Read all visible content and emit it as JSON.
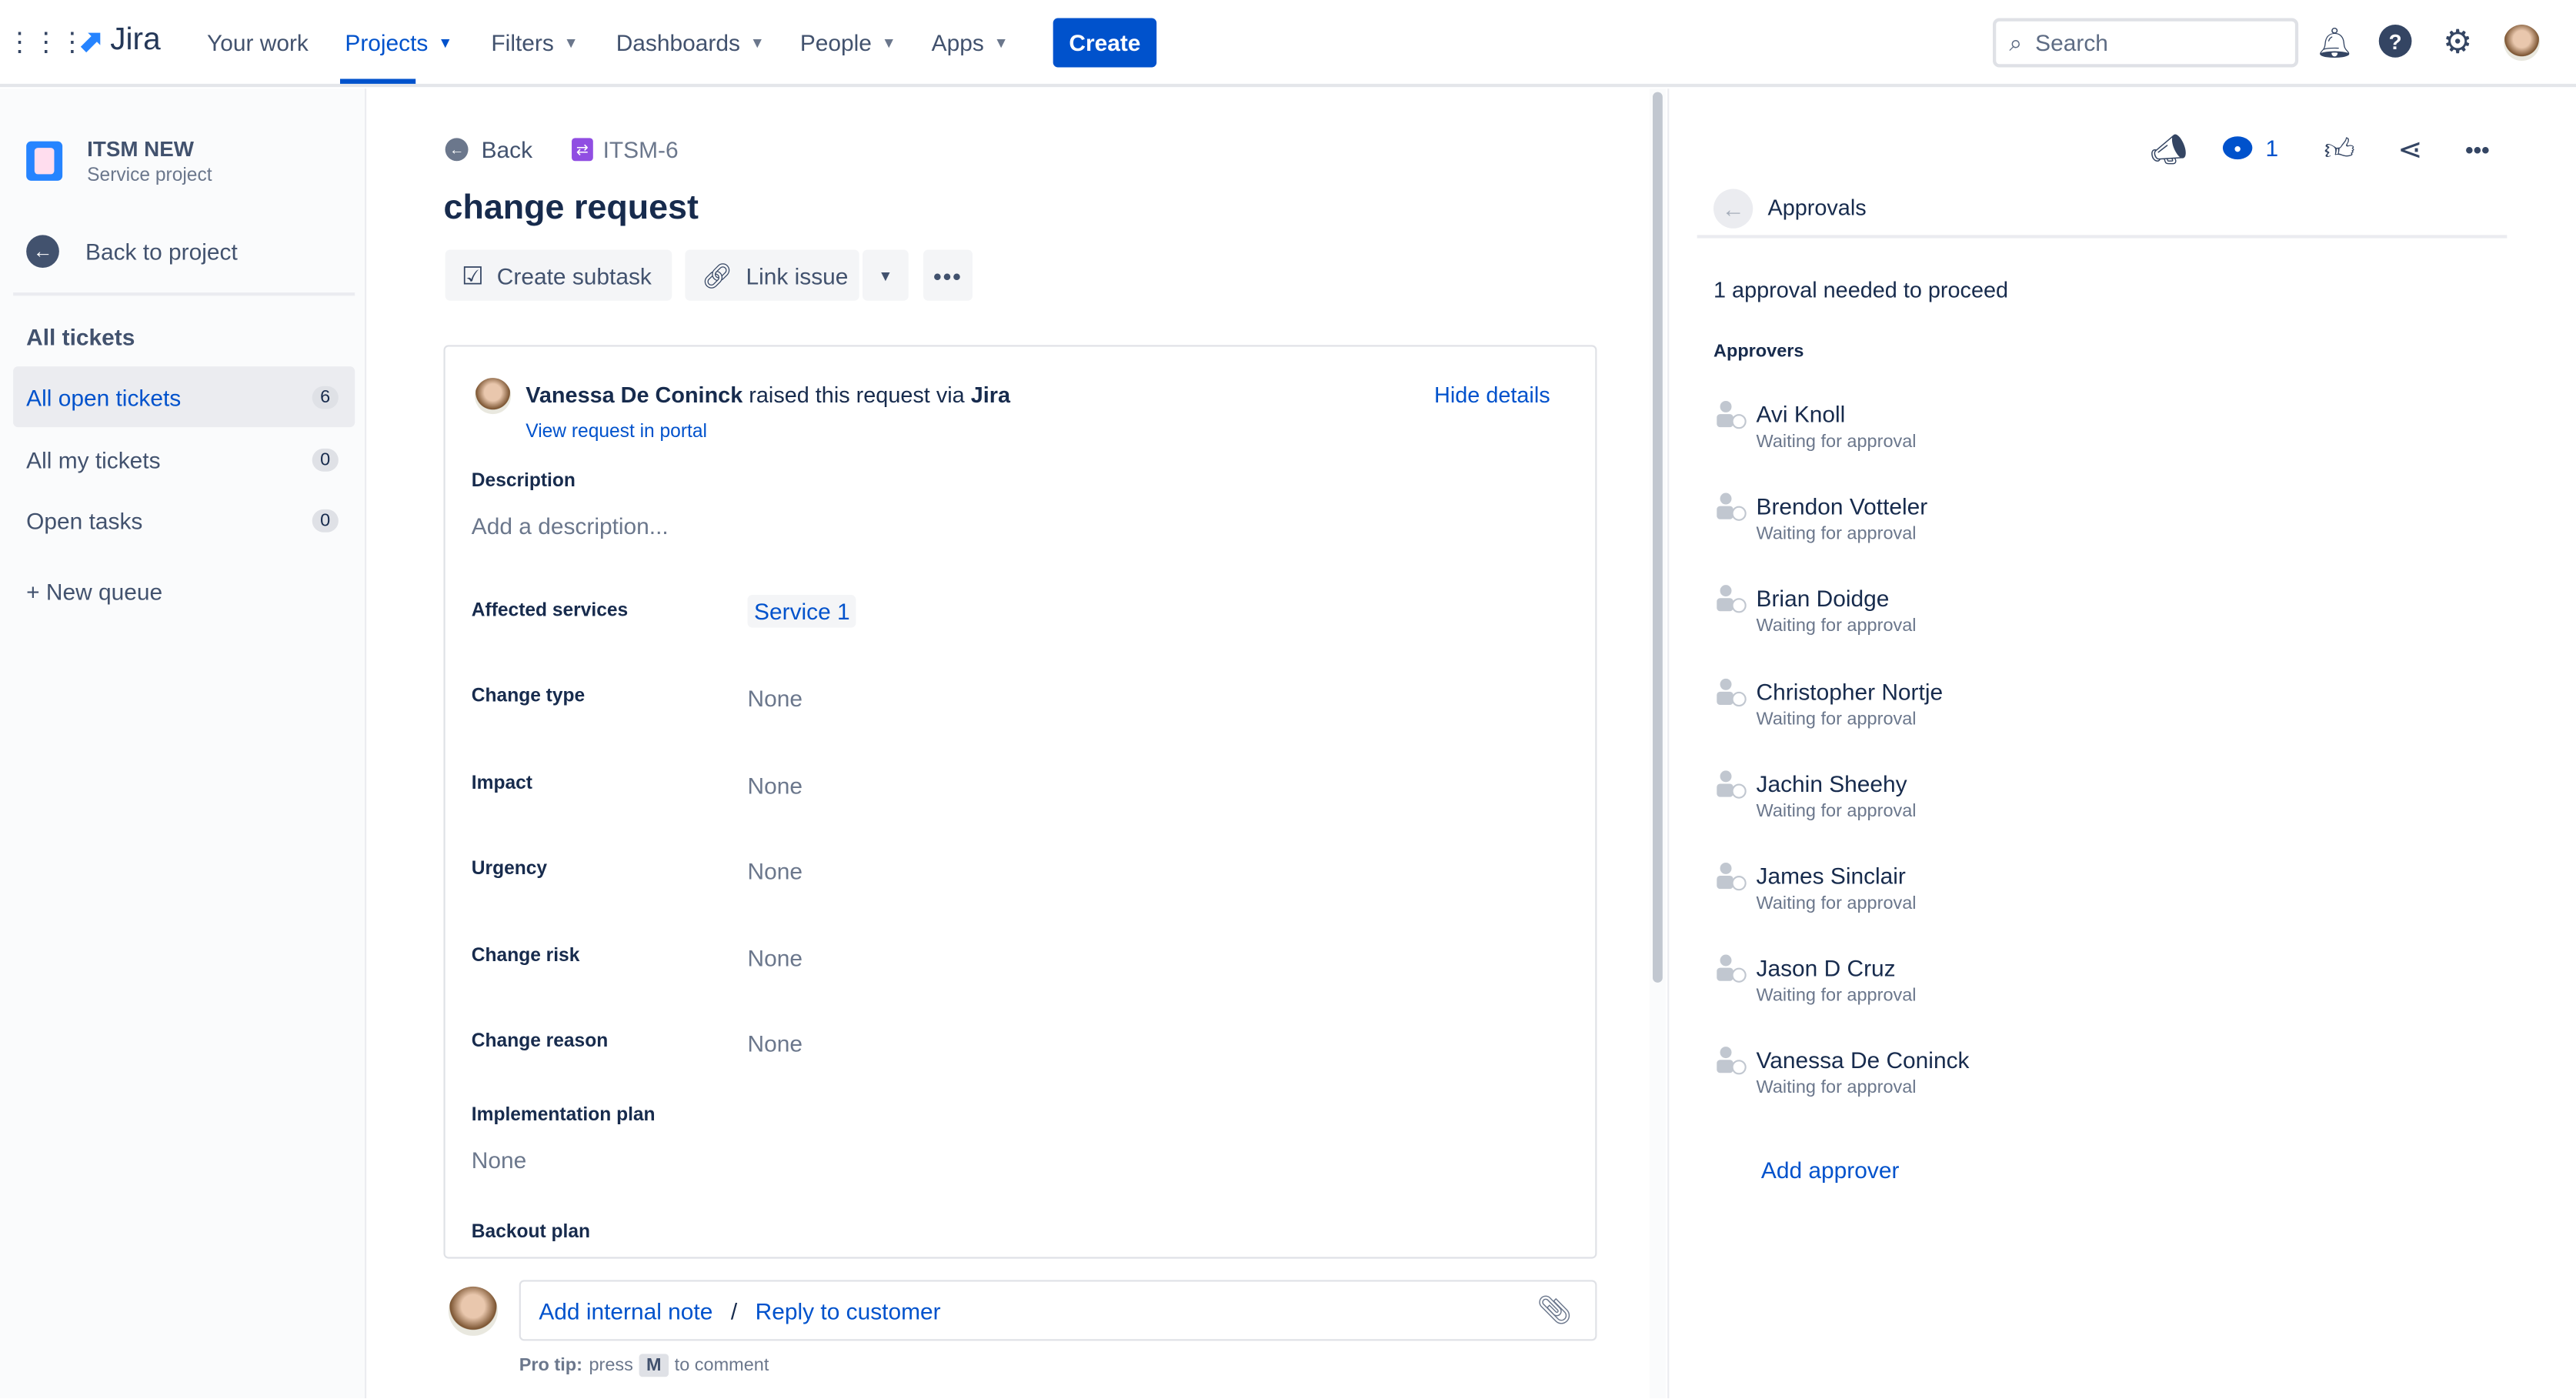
{
  "topnav": {
    "logo": "Jira",
    "items": [
      {
        "label": "Your work"
      },
      {
        "label": "Projects"
      },
      {
        "label": "Filters"
      },
      {
        "label": "Dashboards"
      },
      {
        "label": "People"
      },
      {
        "label": "Apps"
      }
    ],
    "create": "Create",
    "search_placeholder": "Search"
  },
  "sidebar": {
    "project_name": "ITSM NEW",
    "project_type": "Service project",
    "back": "Back to project",
    "section": "All tickets",
    "queues": [
      {
        "label": "All open tickets",
        "count": "6"
      },
      {
        "label": "All my tickets",
        "count": "0"
      },
      {
        "label": "Open tasks",
        "count": "0"
      }
    ],
    "new_queue": "+ New queue"
  },
  "issue": {
    "back": "Back",
    "key": "ITSM-6",
    "title": "change request",
    "create_subtask": "Create subtask",
    "link_issue": "Link issue",
    "reporter": "Vanessa De Coninck",
    "raised_text": "raised this request via",
    "channel": "Jira",
    "hide_details": "Hide details",
    "view_portal": "View request in portal",
    "description_label": "Description",
    "description_placeholder": "Add a description...",
    "fields": [
      {
        "label": "Affected services",
        "value": "Service 1"
      },
      {
        "label": "Change type",
        "value": "None"
      },
      {
        "label": "Impact",
        "value": "None"
      },
      {
        "label": "Urgency",
        "value": "None"
      },
      {
        "label": "Change risk",
        "value": "None"
      },
      {
        "label": "Change reason",
        "value": "None"
      }
    ],
    "impl_label": "Implementation plan",
    "impl_value": "None",
    "backout_label": "Backout plan"
  },
  "comment": {
    "internal": "Add internal note",
    "sep": "/",
    "reply": "Reply to customer",
    "tip_bold": "Pro tip:",
    "tip_press": "press",
    "tip_key": "M",
    "tip_rest": "to comment"
  },
  "panel": {
    "watch_count": "1",
    "title": "Approvals",
    "needed": "1 approval needed to proceed",
    "approvers_label": "Approvers",
    "approvers": [
      {
        "name": "Avi Knoll",
        "status": "Waiting for approval"
      },
      {
        "name": "Brendon Votteler",
        "status": "Waiting for approval"
      },
      {
        "name": "Brian Doidge",
        "status": "Waiting for approval"
      },
      {
        "name": "Christopher Nortje",
        "status": "Waiting for approval"
      },
      {
        "name": "Jachin Sheehy",
        "status": "Waiting for approval"
      },
      {
        "name": "James Sinclair",
        "status": "Waiting for approval"
      },
      {
        "name": "Jason D Cruz",
        "status": "Waiting for approval"
      },
      {
        "name": "Vanessa De Coninck",
        "status": "Waiting for approval"
      }
    ],
    "add_approver": "Add approver"
  }
}
